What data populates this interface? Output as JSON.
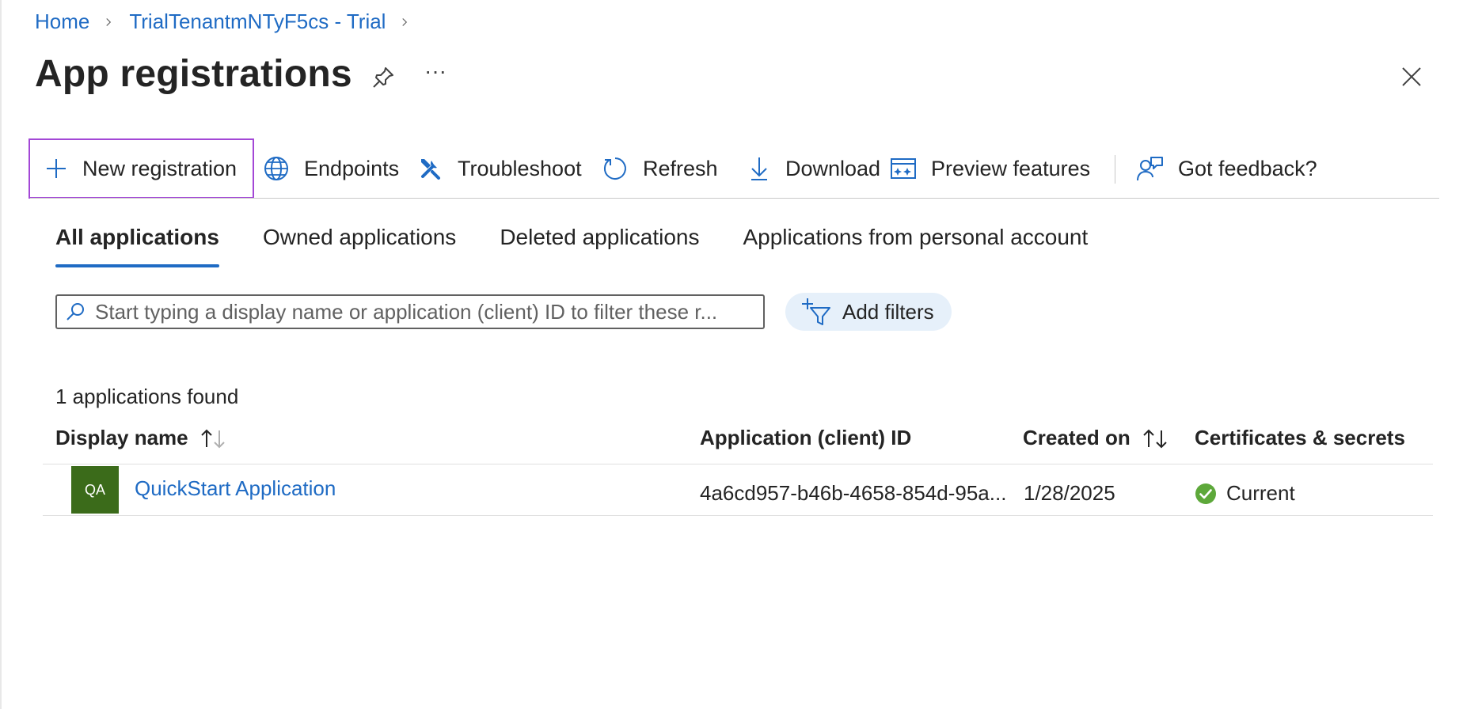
{
  "breadcrumb": {
    "home": "Home",
    "tenant": "TrialTenantmNTyF5cs - Trial"
  },
  "page": {
    "title": "App registrations",
    "more_label": "···"
  },
  "toolbar": {
    "new_registration": "New registration",
    "endpoints": "Endpoints",
    "troubleshoot": "Troubleshoot",
    "refresh": "Refresh",
    "download": "Download",
    "preview_features": "Preview features",
    "feedback": "Got feedback?"
  },
  "tabs": [
    {
      "label": "All applications",
      "active": true
    },
    {
      "label": "Owned applications",
      "active": false
    },
    {
      "label": "Deleted applications",
      "active": false
    },
    {
      "label": "Applications from personal account",
      "active": false
    }
  ],
  "filter": {
    "placeholder": "Start typing a display name or application (client) ID to filter these r...",
    "add_filters": "Add filters"
  },
  "results": {
    "count_text": "1 applications found",
    "columns": {
      "display_name": "Display name",
      "client_id": "Application (client) ID",
      "created_on": "Created on",
      "certificates": "Certificates & secrets"
    },
    "rows": [
      {
        "initials": "QA",
        "name": "QuickStart Application",
        "client_id": "4a6cd957-b46b-4658-854d-95a...",
        "created_on": "1/28/2025",
        "status": "Current"
      }
    ]
  },
  "colors": {
    "link": "#1f6bc4",
    "avatar_bg": "#3b6b1a",
    "status_ok": "#5da83a",
    "focus_outline": "#a347d6",
    "filter_pill": "#e6f0fa"
  }
}
